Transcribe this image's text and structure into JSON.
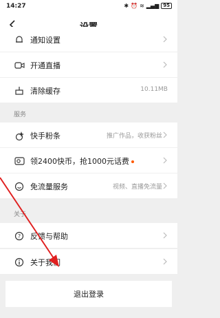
{
  "status_bar": {
    "time": "14:27",
    "signal_text": "ᯤ",
    "battery": "95"
  },
  "nav": {
    "title": "设置"
  },
  "groups": [
    {
      "items": [
        {
          "label": "通知设置",
          "icon": "bell-icon"
        },
        {
          "label": "开通直播",
          "icon": "video-camera-icon"
        },
        {
          "label": "清除缓存",
          "icon": "trash-icon",
          "value": "10.11MB"
        }
      ]
    },
    {
      "title": "服务",
      "items": [
        {
          "label": "快手粉条",
          "icon": "sparkle-icon",
          "value": "推广作品，收获粉丝"
        },
        {
          "label": "领2400快币，抢1000元话费",
          "icon": "coin-card-icon",
          "badge_color": "#ff5a00"
        },
        {
          "label": "免流量服务",
          "icon": "smile-icon",
          "value": "视频、直播免流量"
        }
      ]
    },
    {
      "title": "关于",
      "items": [
        {
          "label": "反馈与帮助",
          "icon": "help-circle-icon"
        },
        {
          "label": "关于我们",
          "icon": "info-circle-icon"
        }
      ]
    }
  ],
  "logout_label": "退出登录",
  "colors": {
    "accent_dot": "#ff5a00",
    "annotation_arrow": "#e02020",
    "background": "#efefef"
  }
}
